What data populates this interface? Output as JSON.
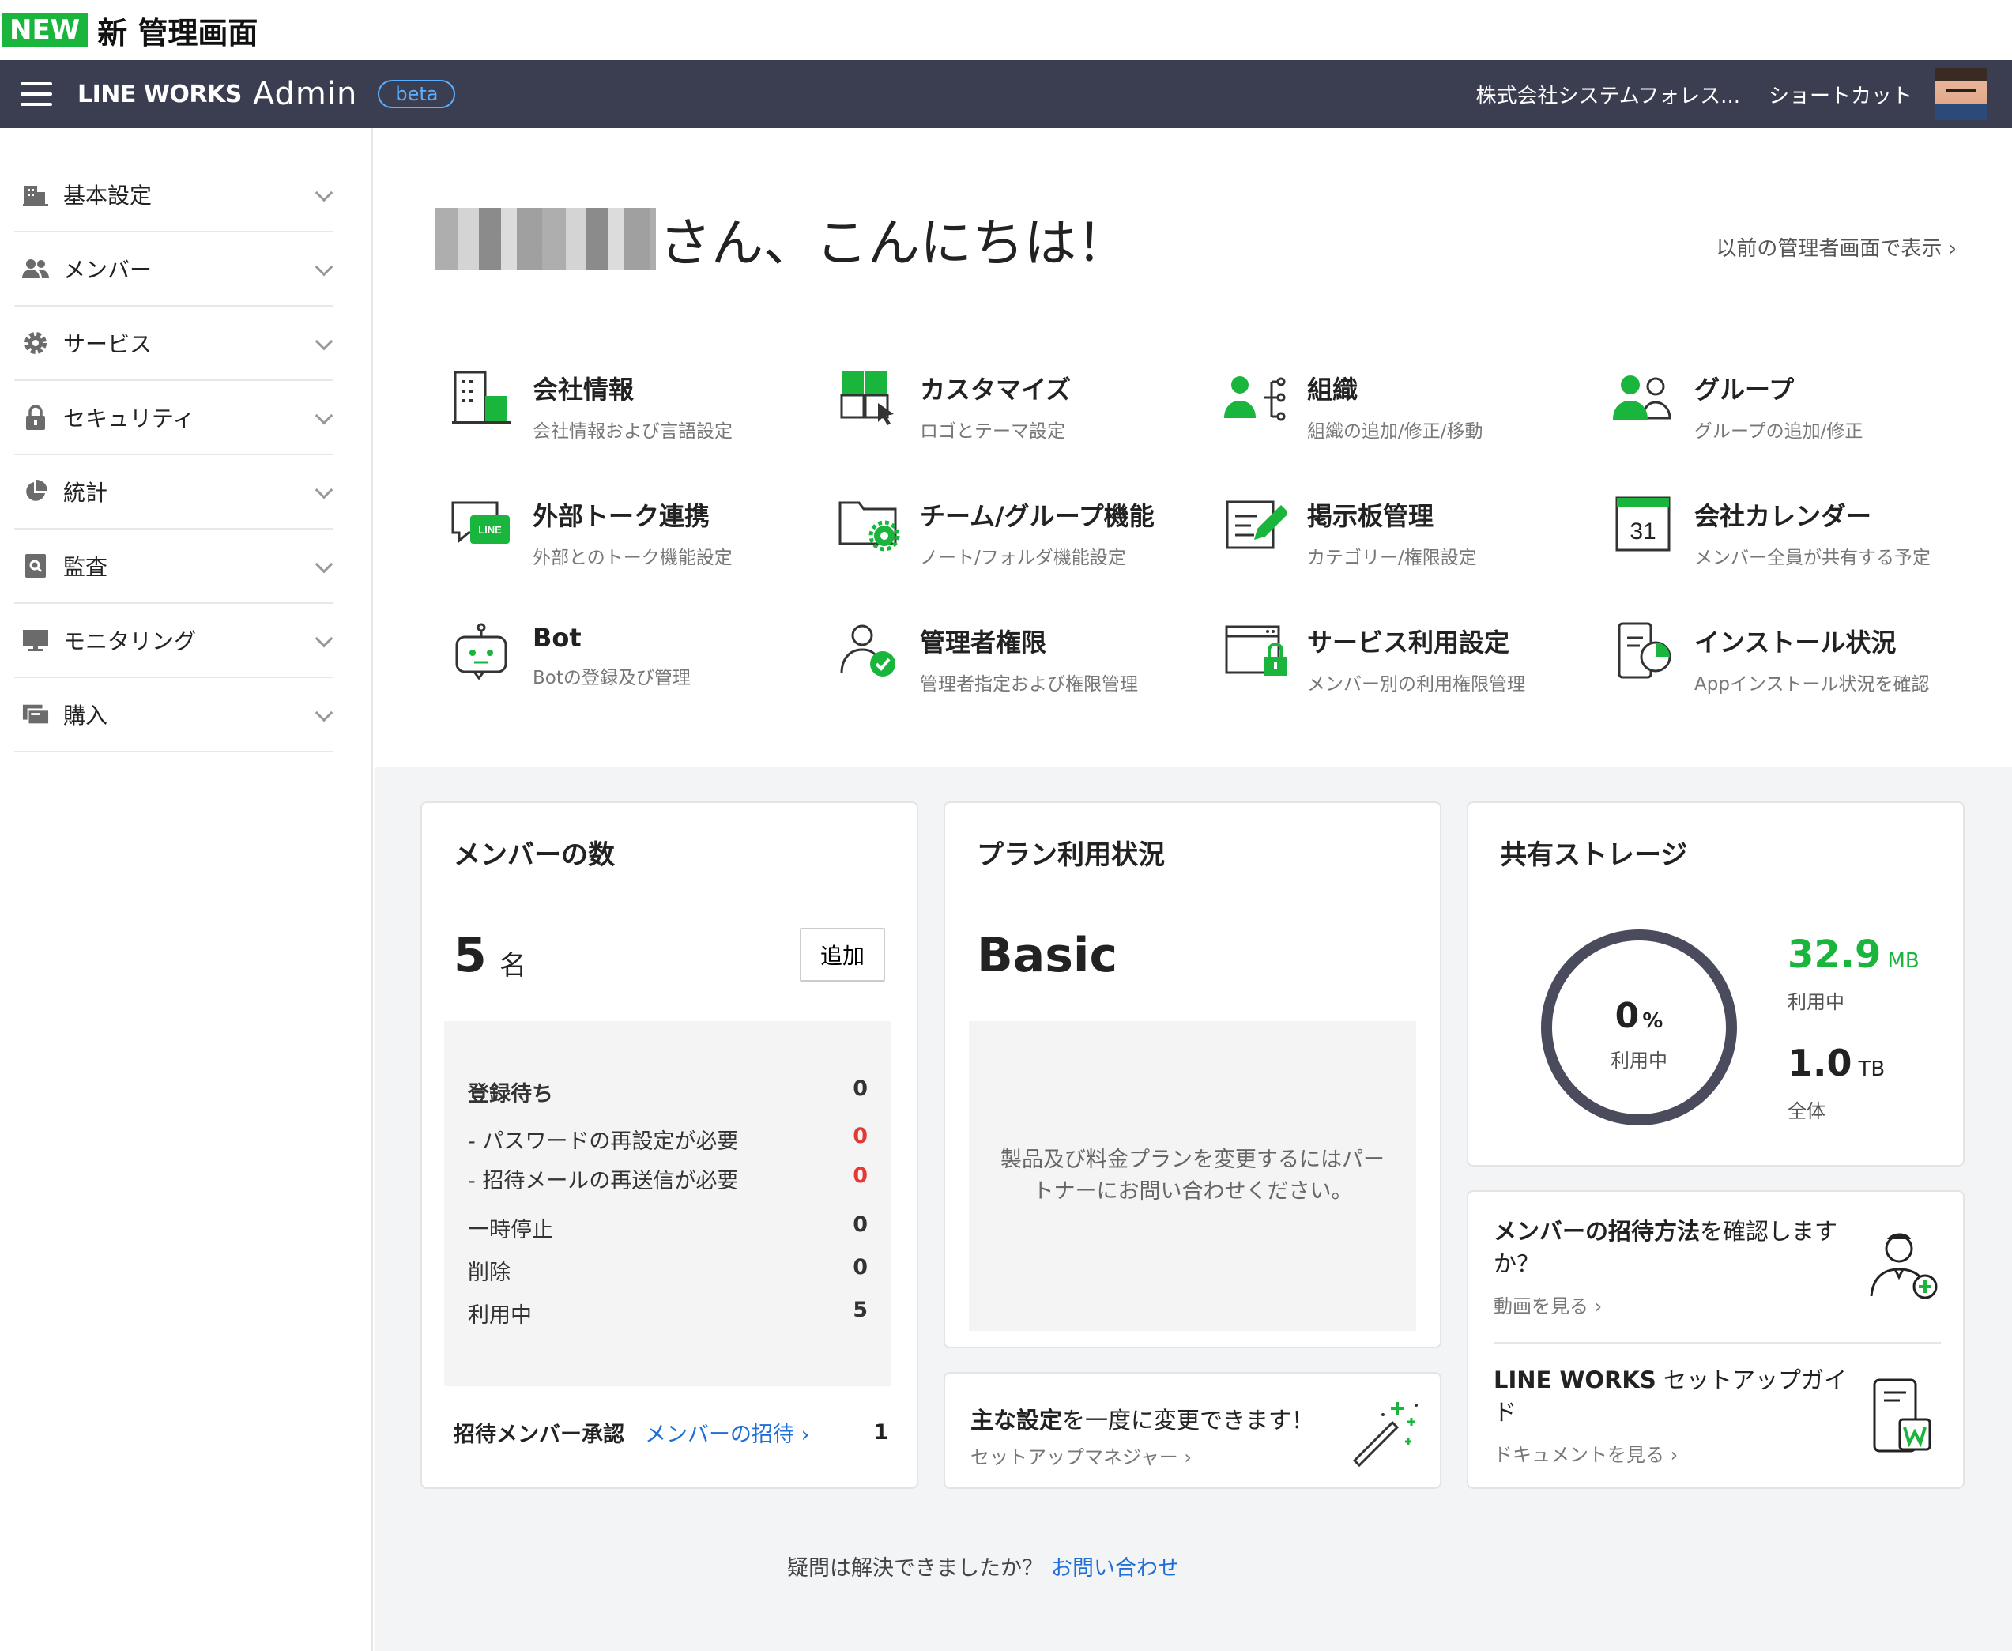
{
  "banner": {
    "badge": "NEW",
    "title": "新 管理画面"
  },
  "header": {
    "brand": "LINE WORKS",
    "admin": "Admin",
    "beta": "beta",
    "company": "株式会社システムフォレス...",
    "shortcut": "ショートカット"
  },
  "sidebar": {
    "items": [
      {
        "label": "基本設定",
        "icon": "building-icon"
      },
      {
        "label": "メンバー",
        "icon": "members-icon"
      },
      {
        "label": "サービス",
        "icon": "gear-icon"
      },
      {
        "label": "セキュリティ",
        "icon": "lock-icon"
      },
      {
        "label": "統計",
        "icon": "pie-chart-icon"
      },
      {
        "label": "監査",
        "icon": "audit-search-icon"
      },
      {
        "label": "モニタリング",
        "icon": "monitor-icon"
      },
      {
        "label": "購入",
        "icon": "purchase-icon"
      }
    ]
  },
  "hero": {
    "greeting": "さん、こんにちは！",
    "prev_link": "以前の管理者画面で表示 ›"
  },
  "menu": [
    {
      "title": "会社情報",
      "desc": "会社情報および言語設定"
    },
    {
      "title": "カスタマイズ",
      "desc": "ロゴとテーマ設定"
    },
    {
      "title": "組織",
      "desc": "組織の追加/修正/移動"
    },
    {
      "title": "グループ",
      "desc": "グループの追加/修正"
    },
    {
      "title": "外部トーク連携",
      "desc": "外部とのトーク機能設定"
    },
    {
      "title": "チーム/グループ機能",
      "desc": "ノート/フォルダ機能設定"
    },
    {
      "title": "掲示板管理",
      "desc": "カテゴリー/権限設定"
    },
    {
      "title": "会社カレンダー",
      "desc": "メンバー全員が共有する予定"
    },
    {
      "title": "Bot",
      "desc": "Botの登録及び管理"
    },
    {
      "title": "管理者権限",
      "desc": "管理者指定および権限管理"
    },
    {
      "title": "サービス利用設定",
      "desc": "メンバー別の利用権限管理"
    },
    {
      "title": "インストール状況",
      "desc": "Appインストール状況を確認"
    }
  ],
  "icon_labels": {
    "line": "LINE",
    "calendar_day": "31"
  },
  "members": {
    "title": "メンバーの数",
    "count": "5",
    "unit": "名",
    "add": "追加",
    "stats": {
      "pending": {
        "label": "登録待ち",
        "value": "0"
      },
      "reset": {
        "label": "- パスワードの再設定が必要",
        "value": "0"
      },
      "resend": {
        "label": "- 招待メールの再送信が必要",
        "value": "0"
      },
      "suspended": {
        "label": "一時停止",
        "value": "0"
      },
      "deleted": {
        "label": "削除",
        "value": "0"
      },
      "active": {
        "label": "利用中",
        "value": "5"
      }
    },
    "approval": {
      "label": "招待メンバー承認",
      "link": "メンバーの招待 ›",
      "value": "1"
    }
  },
  "plan": {
    "title": "プラン利用状況",
    "name": "Basic",
    "note": "製品及び料金プランを変更するにはパートナーにお問い合わせください。"
  },
  "setup": {
    "title_bold": "主な設定",
    "title_rest": "を一度に変更できます！",
    "sub": "セットアップマネジャー ›"
  },
  "storage": {
    "title": "共有ストレージ",
    "percent": "0",
    "percent_unit": "%",
    "percent_label": "利用中",
    "used": "32.9",
    "used_unit": "MB",
    "used_label": "利用中",
    "total": "1.0",
    "total_unit": "TB",
    "total_label": "全体"
  },
  "guide": {
    "invite_bold": "メンバーの招待方法",
    "invite_rest": "を確認しますか？",
    "invite_sub": "動画を見る ›",
    "setup_bold": "LINE WORKS",
    "setup_rest": " セットアップガイド",
    "setup_sub": "ドキュメントを見る ›"
  },
  "footer": {
    "text": "疑問は解決できましたか？",
    "link": "お問い合わせ"
  },
  "colors": {
    "header_bg": "#3b3e51",
    "accent_green": "#19b53c",
    "link_blue": "#1f6fd6",
    "alert_red": "#e53935"
  }
}
